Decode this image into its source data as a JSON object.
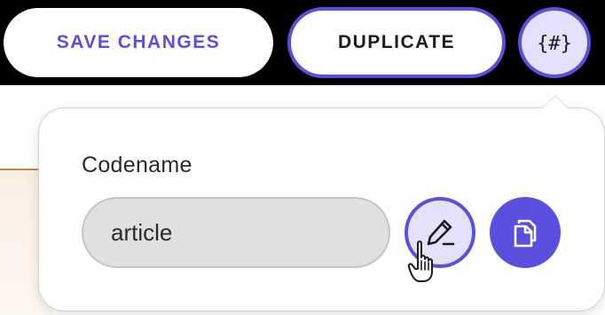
{
  "toolbar": {
    "save_label": "SAVE CHANGES",
    "duplicate_label": "DUPLICATE",
    "codename_toggle_icon": "{#}"
  },
  "popover": {
    "label": "Codename",
    "codename_value": "article",
    "edit_icon": "pencil-icon",
    "copy_icon": "copy-icon"
  },
  "colors": {
    "accent": "#5b4fe0",
    "accent_light": "#e4e1fb",
    "toolbar_bg": "#000000",
    "input_bg": "#e0e0e0"
  }
}
